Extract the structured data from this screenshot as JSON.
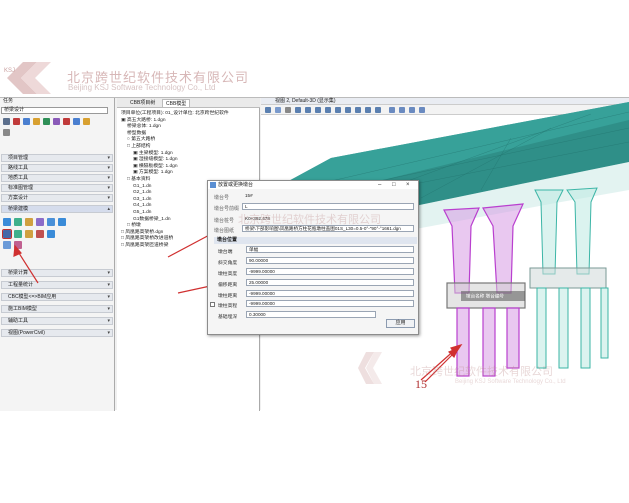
{
  "banner": {
    "company_cn": "北京跨世纪软件技术有限公司",
    "company_en": "Beijing KSJ Software Technology Co., Ltd",
    "logo_letters": "KSJ"
  },
  "left_panel": {
    "top_combo": "任务",
    "task_combo": "桥梁设计",
    "sections": [
      {
        "label": "项目管理"
      },
      {
        "label": "路线工具"
      },
      {
        "label": "地质工具"
      },
      {
        "label": "标准图管理"
      },
      {
        "label": "方案设计"
      },
      {
        "label": "桥梁建模"
      },
      {
        "label": "桥梁计算"
      },
      {
        "label": "工程量统计"
      },
      {
        "label": "CBC模型<=>BIM应用"
      },
      {
        "label": "施工BIM模型"
      },
      {
        "label": "辅助工具"
      },
      {
        "label": "视图(PowerCivil)"
      }
    ]
  },
  "mid_panel": {
    "tabs": [
      "CBB项目树",
      "CBB模型"
    ],
    "tree": [
      "项目单位(工程项目): 01_设计单位: 北京跨世纪软件",
      "▣ 高五大路桥: 1.dgn",
      "  桥梁总体: 1.dgn",
      "  桥型数据",
      "  ○ 第五大路桥",
      "  □ 上部结构",
      "    ▣ 主梁模型: 1.dgn",
      "    ▣ 湿接缝模型: 1.dgn",
      "    ▣ 横隔板模型: 1.dgn",
      "    ▣ 方案模型: 1.dgn",
      "  □ 基本资料",
      "    G1_1.dn",
      "    G2_1.dn",
      "    G3_1.dn",
      "    G4_1.dn",
      "    G5_1.dn",
      "    G1数据桥梁_1.dn",
      "  □ 桥墩",
      "□ 凤凰路高架桥.dgn",
      "□ 凤凰路高架桥改进道桥",
      "□ 凤凰路高架匝道桥梁"
    ]
  },
  "viewport": {
    "title": "视图 2, Default-3D (显示集)",
    "label_tag": "墩台名称 墩台编号"
  },
  "dialog": {
    "title": "放置或更换墩台",
    "fields": [
      {
        "label": "墩台号",
        "value": "15#"
      },
      {
        "label": "墩台号前缀",
        "value": "L"
      },
      {
        "label": "墩台桩号",
        "value": "K0+392.478"
      },
      {
        "label": "墩台图纸",
        "value": "桥梁\\下部影响图\\凤凰路桥方柱花瓶墩柱盖图01S_L30=0.5-0°-\"90°-°1661.dgn"
      }
    ],
    "section_header": "墩台位置",
    "props": [
      {
        "label": "墩台端",
        "value": "单幅"
      },
      {
        "label": "斜交角度",
        "value": "90.00000"
      },
      {
        "label": "墩柱高度",
        "value": "-9999.00000"
      },
      {
        "label": "偏移距离",
        "value": "25.00000"
      },
      {
        "label": "墩柱距离",
        "value": "-9999.00000"
      },
      {
        "label": "墩柱高程",
        "value": "-9999.00000",
        "checkbox": true
      },
      {
        "label": "基础埋深",
        "value": "0.30000"
      }
    ],
    "apply_label": "应用"
  },
  "watermark": {
    "cn": "北京跨世纪软件技术有限公司",
    "en": "Beijing KSJ Software Technology Co., Ltd"
  },
  "annotation_number": "15",
  "colors": {
    "accent_red": "#d03030",
    "deck": "#2aa8a0",
    "pier_magenta": "#b040c0",
    "pier_teal": "#4ec4b4"
  }
}
